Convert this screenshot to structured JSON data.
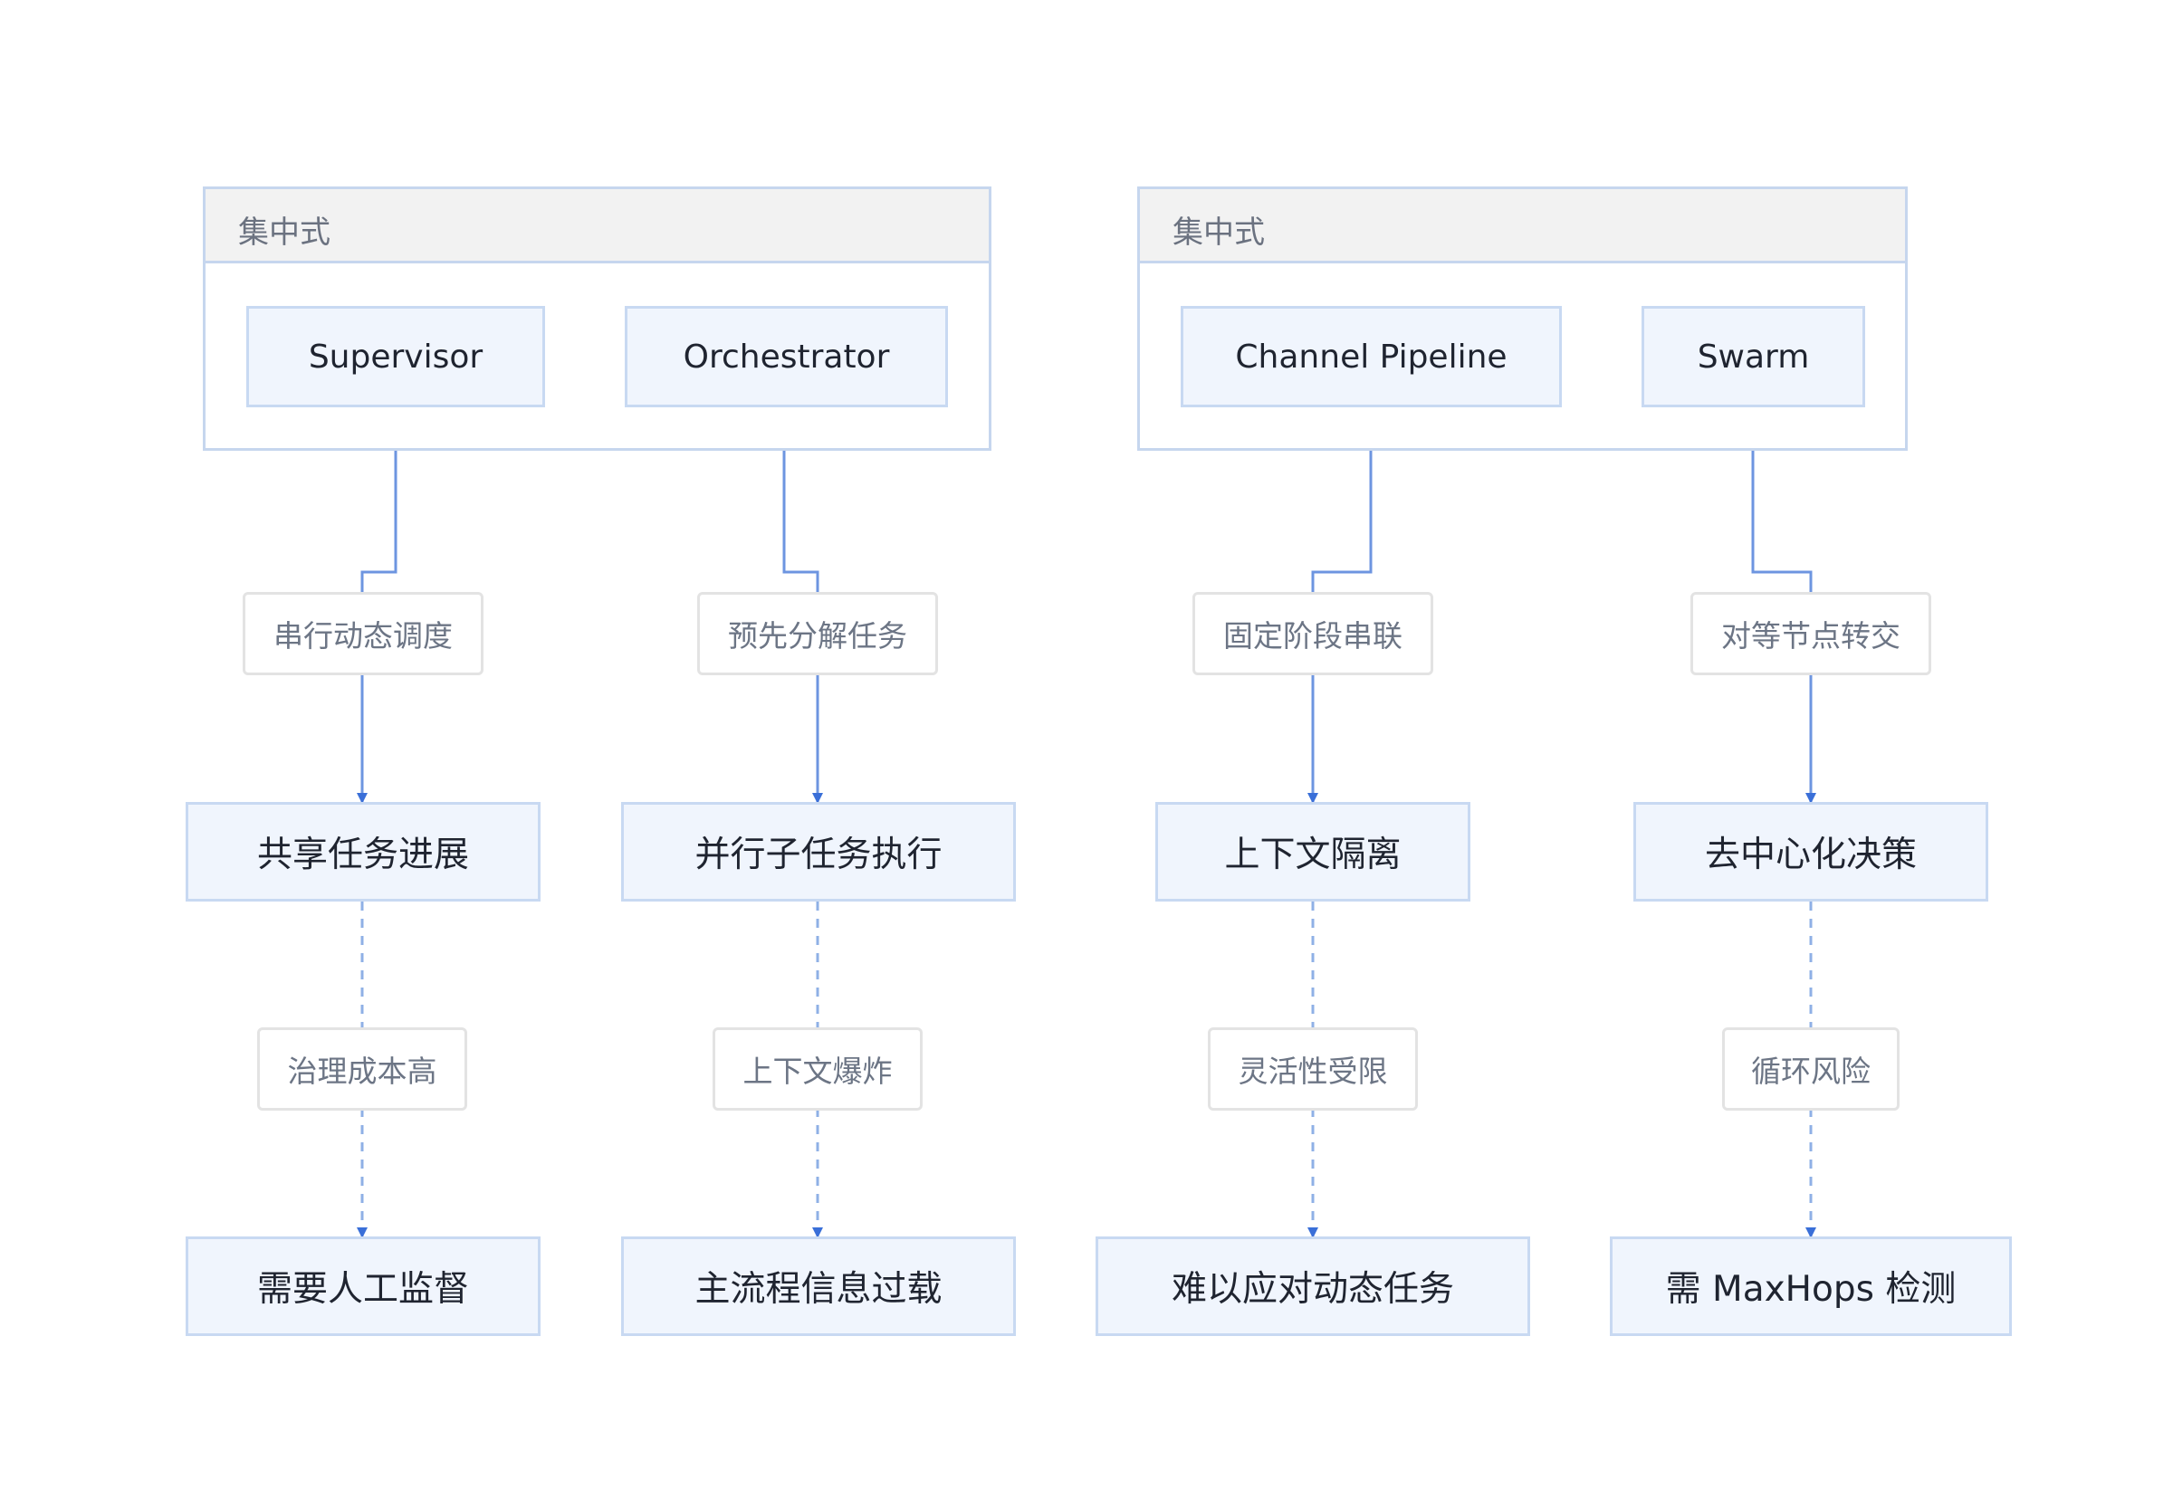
{
  "groups": [
    {
      "title": "集中式"
    },
    {
      "title": "集中式"
    }
  ],
  "top_nodes": [
    "Supervisor",
    "Orchestrator",
    "Channel Pipeline",
    "Swarm"
  ],
  "edge_labels_upper": [
    "串行动态调度",
    "预先分解任务",
    "固定阶段串联",
    "对等节点转交"
  ],
  "mid_nodes": [
    "共享任务进展",
    "并行子任务执行",
    "上下文隔离",
    "去中心化决策"
  ],
  "edge_labels_lower": [
    "治理成本高",
    "上下文爆炸",
    "灵活性受限",
    "循环风险"
  ],
  "bottom_nodes": [
    "需要人工监督",
    "主流程信息过载",
    "难以应对动态任务",
    "需 MaxHops 检测"
  ],
  "colors": {
    "solid_edge": "#6d95e0",
    "dashed_edge": "#8fb0e6",
    "arrowhead": "#3a6fd8",
    "node_fill": "#f0f5fd",
    "node_border": "#c8d9f2",
    "group_border": "#c6d6ee",
    "group_header": "#f2f2f2"
  }
}
